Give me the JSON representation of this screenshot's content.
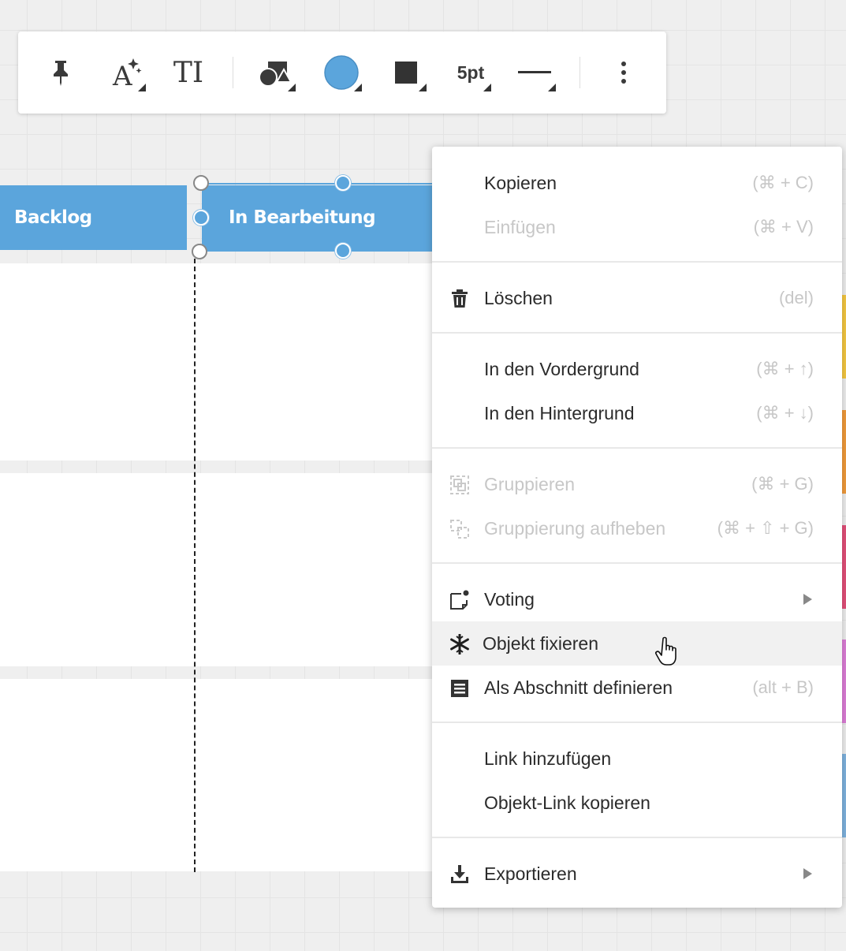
{
  "board": {
    "columns": [
      {
        "label": "Backlog"
      },
      {
        "label": "In Bearbeitung"
      }
    ]
  },
  "toolbar": {
    "items": [
      {
        "icon": "pin-icon"
      },
      {
        "icon": "text-ai-icon"
      },
      {
        "icon": "text-format-icon",
        "label": "TI"
      },
      {
        "icon": "shape-icon"
      },
      {
        "icon": "fill-color-icon",
        "color": "#5ba5dc"
      },
      {
        "icon": "border-color-icon",
        "color": "#333333"
      },
      {
        "icon": "stroke-width-icon",
        "label": "5pt"
      },
      {
        "icon": "line-style-icon"
      },
      {
        "icon": "more-icon"
      }
    ]
  },
  "menu": {
    "items": [
      {
        "label": "Kopieren",
        "shortcut": "(⌘ + C)"
      },
      {
        "label": "Einfügen",
        "shortcut": "(⌘ + V)"
      },
      {
        "label": "Löschen",
        "shortcut": "(del)",
        "icon": "trash-icon"
      },
      {
        "label": "In den Vordergrund",
        "shortcut": "(⌘ + ↑)"
      },
      {
        "label": "In den Hintergrund",
        "shortcut": "(⌘ + ↓)"
      },
      {
        "label": "Gruppieren",
        "shortcut": "(⌘ + G)",
        "icon": "group-icon"
      },
      {
        "label": "Gruppierung aufheben",
        "shortcut": "(⌘ + ⇧ + G)",
        "icon": "ungroup-icon"
      },
      {
        "label": "Voting",
        "icon": "voting-icon"
      },
      {
        "label": "Objekt fixieren",
        "icon": "freeze-icon"
      },
      {
        "label": "Als Abschnitt definieren",
        "shortcut": "(alt + B)",
        "icon": "section-icon"
      },
      {
        "label": "Link hinzufügen"
      },
      {
        "label": "Objekt-Link kopieren"
      },
      {
        "label": "Exportieren",
        "icon": "download-icon"
      }
    ]
  },
  "colors": {
    "accent": "#5ba5dc",
    "notes": [
      "#f6c842",
      "#f29b3b",
      "#e3507a",
      "#dd7ed8",
      "#7fb3df"
    ]
  }
}
